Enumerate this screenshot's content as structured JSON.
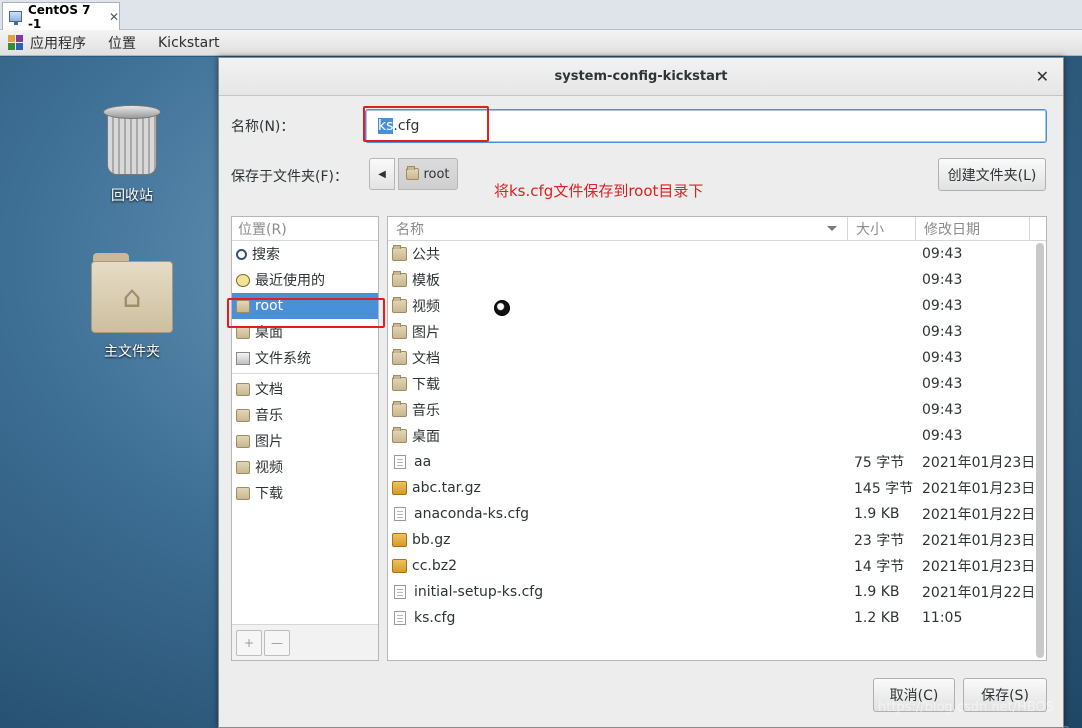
{
  "vm_tab": {
    "title": "CentOS 7 -1",
    "close": "✕"
  },
  "top_panel": {
    "applications": "应用程序",
    "places": "位置",
    "app_name": "Kickstart"
  },
  "desktop": {
    "trash_label": "回收站",
    "home_label": "主文件夹"
  },
  "dialog": {
    "title": "system-config-kickstart",
    "close": "✕",
    "name_label": "名称(N)：",
    "name_value_selected": "ks",
    "name_value_rest": ".cfg",
    "folder_label": "保存于文件夹(F)：",
    "path_back": "◀",
    "path_current": "root",
    "annotation": "将ks.cfg文件保存到root目录下",
    "create_folder": "创建文件夹(L)",
    "cancel": "取消(C)",
    "save": "保存(S)"
  },
  "places": {
    "header": "位置(R)",
    "items": [
      {
        "label": "搜索",
        "icon": "search-icon"
      },
      {
        "label": "最近使用的",
        "icon": "recent-icon"
      },
      {
        "label": "root",
        "icon": "home-icon",
        "selected": true
      },
      {
        "label": "桌面",
        "icon": "desktop-icon"
      },
      {
        "label": "文件系统",
        "icon": "drive-icon"
      }
    ],
    "bookmarks": [
      {
        "label": "文档",
        "icon": "documents-icon"
      },
      {
        "label": "音乐",
        "icon": "music-icon"
      },
      {
        "label": "图片",
        "icon": "pictures-icon"
      },
      {
        "label": "视频",
        "icon": "videos-icon"
      },
      {
        "label": "下载",
        "icon": "downloads-icon"
      }
    ],
    "add": "+",
    "remove": "—"
  },
  "files": {
    "columns": {
      "name": "名称",
      "size": "大小",
      "modified": "修改日期"
    },
    "rows": [
      {
        "name": "公共",
        "size": "",
        "date": "09:43",
        "type": "folder"
      },
      {
        "name": "模板",
        "size": "",
        "date": "09:43",
        "type": "folder"
      },
      {
        "name": "视频",
        "size": "",
        "date": "09:43",
        "type": "folder"
      },
      {
        "name": "图片",
        "size": "",
        "date": "09:43",
        "type": "folder"
      },
      {
        "name": "文档",
        "size": "",
        "date": "09:43",
        "type": "folder"
      },
      {
        "name": "下载",
        "size": "",
        "date": "09:43",
        "type": "folder"
      },
      {
        "name": "音乐",
        "size": "",
        "date": "09:43",
        "type": "folder"
      },
      {
        "name": "桌面",
        "size": "",
        "date": "09:43",
        "type": "folder"
      },
      {
        "name": "aa",
        "size": "75 字节",
        "date": "2021年01月23日",
        "type": "doc"
      },
      {
        "name": "abc.tar.gz",
        "size": "145 字节",
        "date": "2021年01月23日",
        "type": "pkg"
      },
      {
        "name": "anaconda-ks.cfg",
        "size": "1.9 KB",
        "date": "2021年01月22日",
        "type": "doc"
      },
      {
        "name": "bb.gz",
        "size": "23 字节",
        "date": "2021年01月23日",
        "type": "pkg"
      },
      {
        "name": "cc.bz2",
        "size": "14 字节",
        "date": "2021年01月23日",
        "type": "pkg"
      },
      {
        "name": "initial-setup-ks.cfg",
        "size": "1.9 KB",
        "date": "2021年01月22日",
        "type": "doc"
      },
      {
        "name": "ks.cfg",
        "size": "1.2 KB",
        "date": "11:05",
        "type": "doc"
      }
    ]
  },
  "watermark": "https://blog.csdn.net/HBOS",
  "watermark_corner": "C E"
}
